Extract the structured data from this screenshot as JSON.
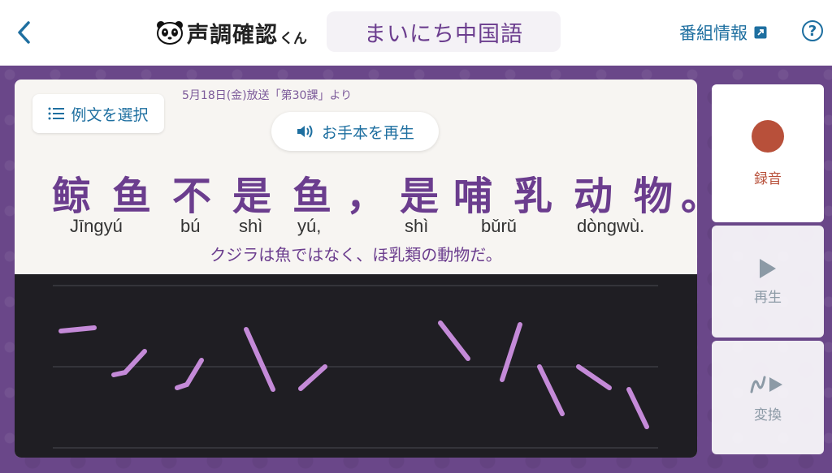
{
  "header": {
    "app_title": "声調確認",
    "app_suffix": "くん",
    "program_name": "まいにち中国語",
    "program_info_label": "番組情報",
    "help_label": "?"
  },
  "card": {
    "select_label": "例文を選択",
    "broadcast_info": "5月18日(金)放送「第30課」より",
    "play_sample_label": "お手本を再生",
    "hanzi": [
      "鲸",
      "鱼",
      "不",
      "是",
      "鱼",
      "，",
      "是",
      "哺",
      "乳",
      "动",
      "物",
      "。"
    ],
    "pinyin": [
      "Jīngyú",
      "bú",
      "shì",
      "yú,",
      "shì",
      "bǔrǔ",
      "dòngwù."
    ],
    "translation": "クジラは魚ではなく、ほ乳類の動物だ。"
  },
  "side": {
    "record_label": "録音",
    "play_label": "再生",
    "convert_label": "変換"
  },
  "colors": {
    "accent_purple": "#6b3d8e",
    "link_blue": "#1e6fa0",
    "record_red": "#b8503a",
    "pitch_stroke": "#c48ad8",
    "pitch_bg": "#1f1e23"
  }
}
